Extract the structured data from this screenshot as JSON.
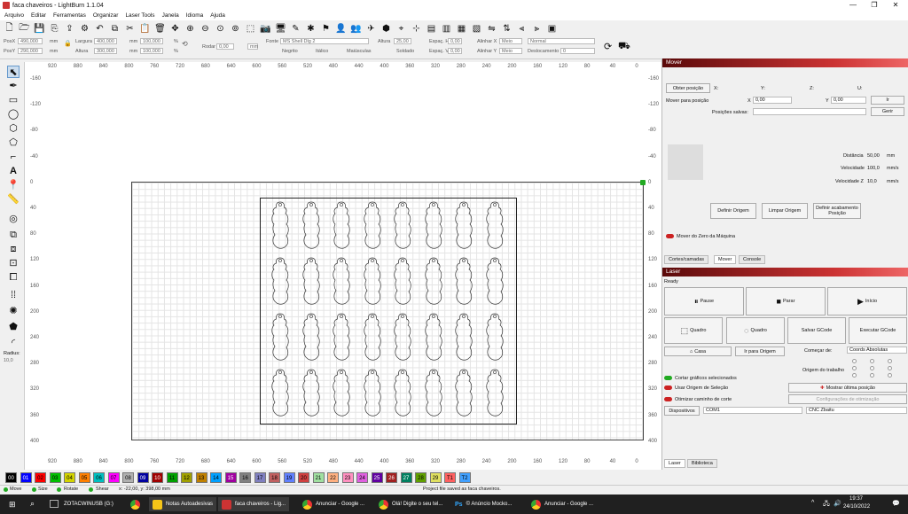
{
  "window": {
    "title": "faca chaveiros - LightBurn 1.1.04",
    "min": "—",
    "max": "❐",
    "close": "✕"
  },
  "menu": [
    "Arquivo",
    "Editar",
    "Ferramentas",
    "Organizar",
    "Laser Tools",
    "Janela",
    "Idioma",
    "Ajuda"
  ],
  "props": {
    "posx_label": "PosX",
    "posx": "490,000",
    "posy_label": "PosY",
    "posy": "290,000",
    "unit": "mm",
    "largura_label": "Largura",
    "largura": "400,000",
    "altura_label": "Altura",
    "altura": "300,000",
    "pct_w": "100,000",
    "pct_h": "100,000",
    "pct": "%",
    "rotate_label": "Rodar",
    "rotate": "0,00",
    "unit2": "mm",
    "font_label": "Fonte",
    "font": "MS Shell Dlg 2",
    "alt_label": "Altura",
    "alt": "25,00",
    "esph_label": "Espaç. H",
    "esph": "0,00",
    "espv_label": "Espaç. V",
    "espv": "0,00",
    "alinx_label": "Alinhar X",
    "alinx": "Meio",
    "aliny_label": "Alinhar Y",
    "aliny": "Meio",
    "normal": "Normal",
    "desloc_label": "Deslocamento",
    "desloc": "0",
    "negrito": "Negrito",
    "italico": "Itálico",
    "maiusculas": "Maiúsculas",
    "soldado": "Soldado",
    "radius_label": "Radius:",
    "radius": "10,0"
  },
  "ruler": {
    "top": [
      "920",
      "880",
      "840",
      "800",
      "760",
      "720",
      "680",
      "640",
      "600",
      "560",
      "520",
      "480",
      "440",
      "400",
      "360",
      "320",
      "280",
      "240",
      "200",
      "160",
      "120",
      "80",
      "40",
      "0"
    ],
    "left": [
      "-160",
      "-120",
      "-80",
      "-40",
      "0",
      "40",
      "80",
      "120",
      "160",
      "200",
      "240",
      "280",
      "320",
      "360",
      "400"
    ],
    "right": [
      "-160",
      "-120",
      "-80",
      "-40",
      "0",
      "40",
      "80",
      "120",
      "160",
      "200",
      "240",
      "280",
      "320",
      "360",
      "400"
    ],
    "bottom": [
      "920",
      "880",
      "840",
      "800",
      "760",
      "720",
      "680",
      "640",
      "600",
      "560",
      "520",
      "480",
      "440",
      "400",
      "360",
      "320",
      "280",
      "240",
      "200",
      "160",
      "120",
      "80",
      "40",
      "0"
    ]
  },
  "mover": {
    "title": "Mover",
    "get_pos": "Obter posição",
    "x": "X:",
    "y": "Y:",
    "z": "Z:",
    "u": "U:",
    "move_to": "Mover para posição",
    "xl": "X",
    "xv": "0,00",
    "yl": "Y",
    "yv": "0,00",
    "go": "Ir",
    "saved": "Posições salvas:",
    "manage": "Gerir",
    "dist_label": "Distância",
    "dist": "50,00",
    "dist_unit": "mm",
    "vel_label": "Velocidade",
    "vel": "100,0",
    "vel_unit": "mm/s",
    "velz_label": "Velocidade Z",
    "velz": "10,0",
    "velz_unit": "mm/s",
    "def_origin": "Definir Origem",
    "clear_origin": "Limpar Origem",
    "def_finish": "Definir acabamento Posição",
    "zero": "Mover do Zero da Máquina",
    "tabs": [
      "Cortes/camadas",
      "Mover",
      "Console"
    ]
  },
  "laser": {
    "title": "Laser",
    "status": "Ready",
    "pause": "Pause",
    "stop": "Parar",
    "start": "Início",
    "frame1": "Quadro",
    "frame2": "Quadro",
    "save_gcode": "Salvar GCode",
    "run_gcode": "Executar GCode",
    "home": "Casa",
    "go_origin": "Ir para Origem",
    "start_from": "Começar de:",
    "start_from_val": "Coords Absolutas",
    "job_origin": "Origem do trabalho",
    "cut_selected": "Cortar gráficos selecionados",
    "use_sel_origin": "Usar Origem de Seleção",
    "optimize": "Otimizar caminho de corte",
    "show_last": "Mostrar última posição",
    "opt_settings": "Configurações de otimização",
    "devices": "Dispositivos",
    "port": "COM1",
    "device": "CNC Zbaitu",
    "tabs": [
      "Laser",
      "Biblioteca"
    ]
  },
  "palette": [
    {
      "label": "00",
      "color": "#000000",
      "fg": "#ffffff"
    },
    {
      "label": "01",
      "color": "#0000ff",
      "fg": "#ffffff"
    },
    {
      "label": "02",
      "color": "#ff0000",
      "fg": "#000000"
    },
    {
      "label": "03",
      "color": "#00c000",
      "fg": "#000000"
    },
    {
      "label": "04",
      "color": "#d4d400",
      "fg": "#000000"
    },
    {
      "label": "05",
      "color": "#ff8000",
      "fg": "#000000"
    },
    {
      "label": "06",
      "color": "#00c0c0",
      "fg": "#000000"
    },
    {
      "label": "07",
      "color": "#ff00ff",
      "fg": "#000000"
    },
    {
      "label": "08",
      "color": "#b0b0b0",
      "fg": "#000000"
    },
    {
      "label": "09",
      "color": "#0000a0",
      "fg": "#ffffff"
    },
    {
      "label": "10",
      "color": "#a00000",
      "fg": "#ffffff"
    },
    {
      "label": "11",
      "color": "#00a000",
      "fg": "#000000"
    },
    {
      "label": "12",
      "color": "#a0a000",
      "fg": "#000000"
    },
    {
      "label": "13",
      "color": "#c08000",
      "fg": "#000000"
    },
    {
      "label": "14",
      "color": "#00a0ff",
      "fg": "#000000"
    },
    {
      "label": "15",
      "color": "#a000a0",
      "fg": "#ffffff"
    },
    {
      "label": "16",
      "color": "#808080",
      "fg": "#000000"
    },
    {
      "label": "17",
      "color": "#8080c0",
      "fg": "#000000"
    },
    {
      "label": "18",
      "color": "#c06060",
      "fg": "#000000"
    },
    {
      "label": "19",
      "color": "#6080ff",
      "fg": "#000000"
    },
    {
      "label": "20",
      "color": "#d04040",
      "fg": "#000000"
    },
    {
      "label": "21",
      "color": "#a0e0a0",
      "fg": "#000000"
    },
    {
      "label": "22",
      "color": "#ffb080",
      "fg": "#000000"
    },
    {
      "label": "23",
      "color": "#ff90c0",
      "fg": "#000000"
    },
    {
      "label": "24",
      "color": "#e060e0",
      "fg": "#000000"
    },
    {
      "label": "25",
      "color": "#6000a0",
      "fg": "#ffffff"
    },
    {
      "label": "26",
      "color": "#a02020",
      "fg": "#ffffff"
    },
    {
      "label": "27",
      "color": "#008060",
      "fg": "#ffffff"
    },
    {
      "label": "28",
      "color": "#60a000",
      "fg": "#000000"
    },
    {
      "label": "29",
      "color": "#e0e060",
      "fg": "#000000"
    },
    {
      "label": "T1",
      "color": "#ff6060",
      "fg": "#000000"
    },
    {
      "label": "T2",
      "color": "#40a0ff",
      "fg": "#000000"
    }
  ],
  "status": {
    "move": "Move",
    "size": "Size",
    "rotate": "Rotate",
    "shear": "Shear",
    "coords": "x: -22,00, y: 398,00 mm",
    "msg": "Project file saved as faca chaveiros."
  },
  "taskbar": {
    "items": [
      "ZOTACWINUSB (G:)",
      "Notas Autoadesivas",
      "faca chaveiros - Lig...",
      "Anunciar - Google ...",
      "Olá! Digite o seu tel...",
      "© Anúncio Mocko...",
      "Anunciar - Google ..."
    ],
    "time": "19:37",
    "date": "24/10/2022"
  }
}
